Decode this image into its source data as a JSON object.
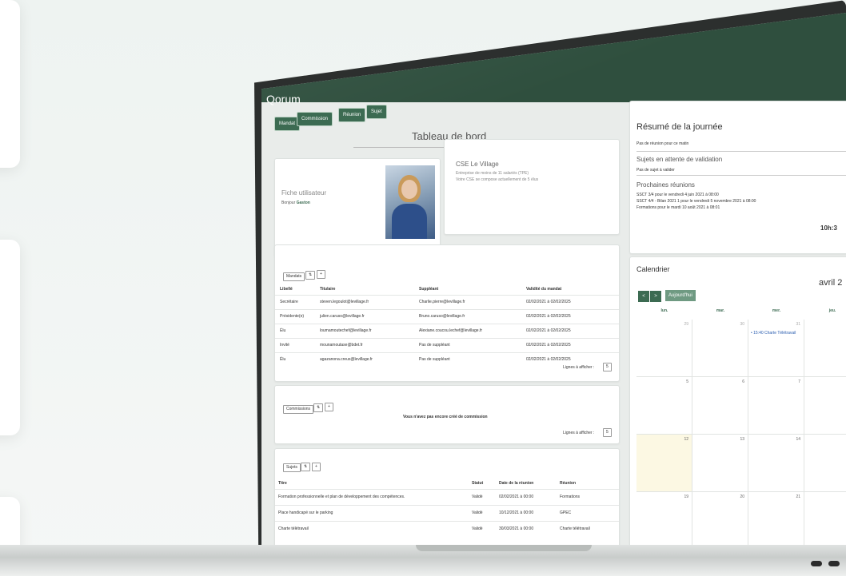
{
  "app": {
    "logo": "Qorum"
  },
  "nav": [
    "Mandat",
    "Commission",
    "Réunion",
    "Sujet"
  ],
  "dashboard": {
    "title": "Tableau de bord"
  },
  "user_card": {
    "title": "Fiche utilisateur",
    "greeting": "Bonjour",
    "name": "Gaston"
  },
  "cse": {
    "title": "CSE Le Village",
    "line1": "Entreprise de moins de 11 salariés (TPE)",
    "line2": "Votre CSE se compose actuellement de 5 élus"
  },
  "mandats": {
    "button": "Mandats",
    "headers": [
      "Libellé",
      "Titulaire",
      "Suppléant",
      "Validité du mandat"
    ],
    "rows": [
      [
        "Secrétaire",
        "steven.legoulot@levillage.fr",
        "Charlie.pierre@levillage.fr",
        "02/02/2021 à 02/02/2025"
      ],
      [
        "Présidente(e)",
        "julien.caruso@levillage.fr",
        "Bruno.caruso@levillage.fr",
        "02/02/2021 à 02/02/2025"
      ],
      [
        "Élu",
        "loumamoutechef@levillage.fr",
        "Alexiane.coucou.lechef@levillage.fr",
        "02/02/2021 à 02/02/2025"
      ],
      [
        "Invité",
        "mounamoutase@bdet.fr",
        "Pas de suppléant",
        "02/02/2021 à 02/02/2025"
      ],
      [
        "Élu",
        "agazanona.creux@levillage.fr",
        "Pas de suppléant",
        "02/02/2021 à 02/02/2025"
      ]
    ],
    "lines_label": "Lignes à afficher :",
    "lines_value": "5"
  },
  "commissions": {
    "button": "Commissions",
    "empty": "Vous n'avez pas encore créé de commission",
    "lines_label": "Lignes à afficher :",
    "lines_value": "5"
  },
  "sujets": {
    "button": "Sujets",
    "headers": [
      "Titre",
      "Statut",
      "Date de la réunion",
      "Réunion"
    ],
    "rows": [
      [
        "Formation professionnelle et plan de développement des compétences.",
        "Validé",
        "02/02/2021 à 00:00",
        "Formations"
      ],
      [
        "Place handicapé sur le parking",
        "Validé",
        "10/12/2021 à 00:00",
        "GPEC"
      ],
      [
        "Charte télétravail",
        "Validé",
        "30/03/2021 à 00:00",
        "Charte télétravail"
      ]
    ]
  },
  "summary": {
    "title": "Résumé de la journée",
    "no_meeting": "Pas de réunion pour ce matin",
    "pending_title": "Sujets en attente de validation",
    "pending_text": "Pas de sujet à valider",
    "next_title": "Prochaines réunions",
    "next_items": [
      "SSCT 3/4 pour le vendredi 4 juin 2021 à 08:00",
      "SSCT 4/4 - Bilan 2021 1 pour le vendredi 5 novembre 2021 à 08:00",
      "Formations pour le mardi 10 août 2021 à 08:01"
    ],
    "time": "10h:3"
  },
  "calendar": {
    "title": "Calendrier",
    "month": "avril 2",
    "prev": "<",
    "next": ">",
    "today": "Aujourd'hui",
    "days": [
      "lun.",
      "mar.",
      "mer.",
      "jeu."
    ],
    "event": "• 15:40 Charte Télétravail",
    "weeks": [
      [
        "29",
        "30",
        "31",
        ""
      ],
      [
        "5",
        "6",
        "7",
        ""
      ],
      [
        "12",
        "13",
        "14",
        ""
      ],
      [
        "19",
        "20",
        "21",
        ""
      ]
    ]
  }
}
